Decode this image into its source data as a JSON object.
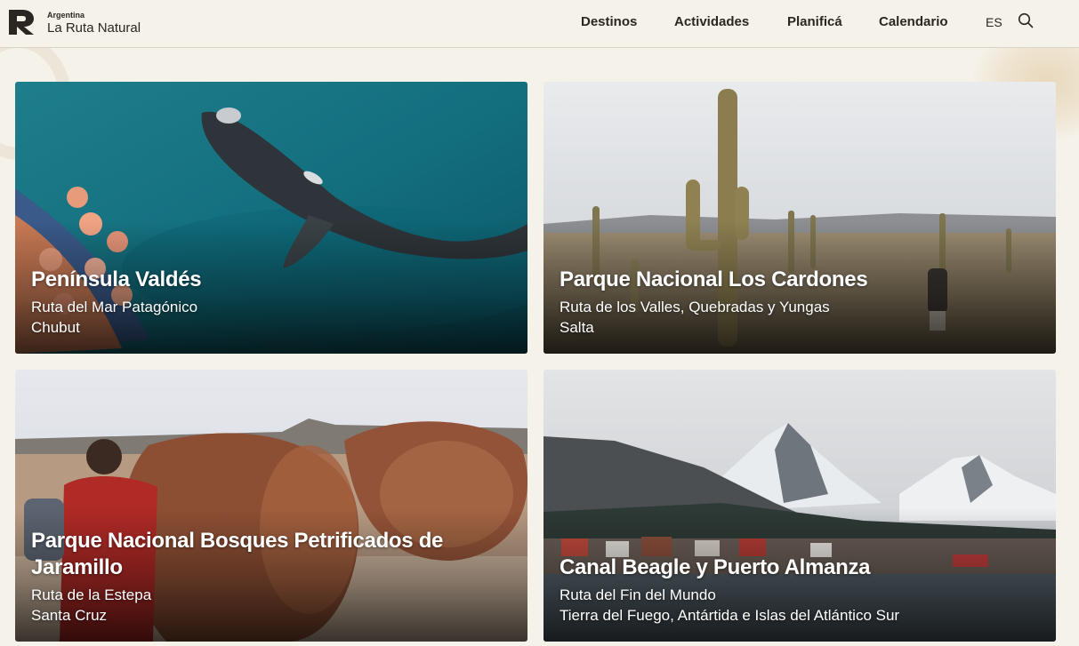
{
  "brand": {
    "small": "Argentina",
    "name": "La Ruta Natural"
  },
  "nav": {
    "items": [
      {
        "label": "Destinos"
      },
      {
        "label": "Actividades"
      },
      {
        "label": "Planificá"
      },
      {
        "label": "Calendario"
      }
    ],
    "language": "ES"
  },
  "cards": [
    {
      "title": "Península Valdés",
      "route": "Ruta del Mar Patagónico",
      "province": "Chubut"
    },
    {
      "title": "Parque Nacional Los Cardones",
      "route": "Ruta de los Valles, Quebradas y Yungas",
      "province": "Salta"
    },
    {
      "title": "Parque Nacional Bosques Petrificados de Jaramillo",
      "route": "Ruta de la Estepa",
      "province": "Santa Cruz"
    },
    {
      "title": "Canal Beagle y Puerto Almanza",
      "route": "Ruta del Fin del Mundo",
      "province": "Tierra del Fuego, Antártida e Islas del Atlántico Sur"
    }
  ],
  "colors": {
    "background": "#f5f2ea",
    "text": "#2b2622",
    "card_text": "#ffffff"
  }
}
